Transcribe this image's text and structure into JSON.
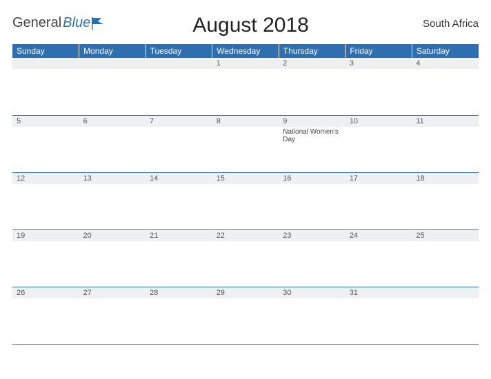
{
  "brand": {
    "part1": "General",
    "part2": "Blue"
  },
  "title": "August 2018",
  "region": "South Africa",
  "colors": {
    "accent": "#2f6fb0",
    "strip": "#eef0f2"
  },
  "day_headers": [
    "Sunday",
    "Monday",
    "Tuesday",
    "Wednesday",
    "Thursday",
    "Friday",
    "Saturday"
  ],
  "weeks": [
    [
      {
        "n": "",
        "e": ""
      },
      {
        "n": "",
        "e": ""
      },
      {
        "n": "",
        "e": ""
      },
      {
        "n": "1",
        "e": ""
      },
      {
        "n": "2",
        "e": ""
      },
      {
        "n": "3",
        "e": ""
      },
      {
        "n": "4",
        "e": ""
      }
    ],
    [
      {
        "n": "5",
        "e": ""
      },
      {
        "n": "6",
        "e": ""
      },
      {
        "n": "7",
        "e": ""
      },
      {
        "n": "8",
        "e": ""
      },
      {
        "n": "9",
        "e": "National Women's Day"
      },
      {
        "n": "10",
        "e": ""
      },
      {
        "n": "11",
        "e": ""
      }
    ],
    [
      {
        "n": "12",
        "e": ""
      },
      {
        "n": "13",
        "e": ""
      },
      {
        "n": "14",
        "e": ""
      },
      {
        "n": "15",
        "e": ""
      },
      {
        "n": "16",
        "e": ""
      },
      {
        "n": "17",
        "e": ""
      },
      {
        "n": "18",
        "e": ""
      }
    ],
    [
      {
        "n": "19",
        "e": ""
      },
      {
        "n": "20",
        "e": ""
      },
      {
        "n": "21",
        "e": ""
      },
      {
        "n": "22",
        "e": ""
      },
      {
        "n": "23",
        "e": ""
      },
      {
        "n": "24",
        "e": ""
      },
      {
        "n": "25",
        "e": ""
      }
    ],
    [
      {
        "n": "26",
        "e": ""
      },
      {
        "n": "27",
        "e": ""
      },
      {
        "n": "28",
        "e": ""
      },
      {
        "n": "29",
        "e": ""
      },
      {
        "n": "30",
        "e": ""
      },
      {
        "n": "31",
        "e": ""
      },
      {
        "n": "",
        "e": ""
      }
    ]
  ]
}
